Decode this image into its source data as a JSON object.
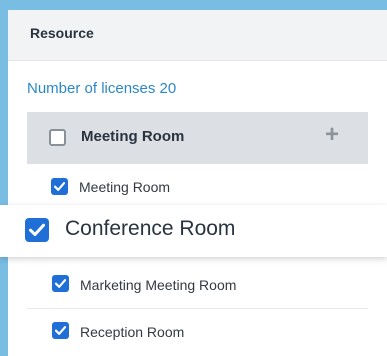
{
  "header": {
    "title": "Resource"
  },
  "licenses_text": "Number of licenses 20",
  "group": {
    "label": "Meeting Room",
    "add_symbol": "+"
  },
  "items": [
    {
      "label": "Meeting Room",
      "checked": true
    },
    {
      "label": "Conference Room",
      "checked": true,
      "highlighted": true
    },
    {
      "label": "Marketing Meeting Room",
      "checked": true
    },
    {
      "label": "Reception Room",
      "checked": true
    }
  ],
  "colors": {
    "accent": "#2b88c8",
    "checkbox": "#1f6fd6",
    "background": "#79bde3"
  },
  "icons": {
    "check": "check-icon",
    "add": "plus-icon"
  }
}
